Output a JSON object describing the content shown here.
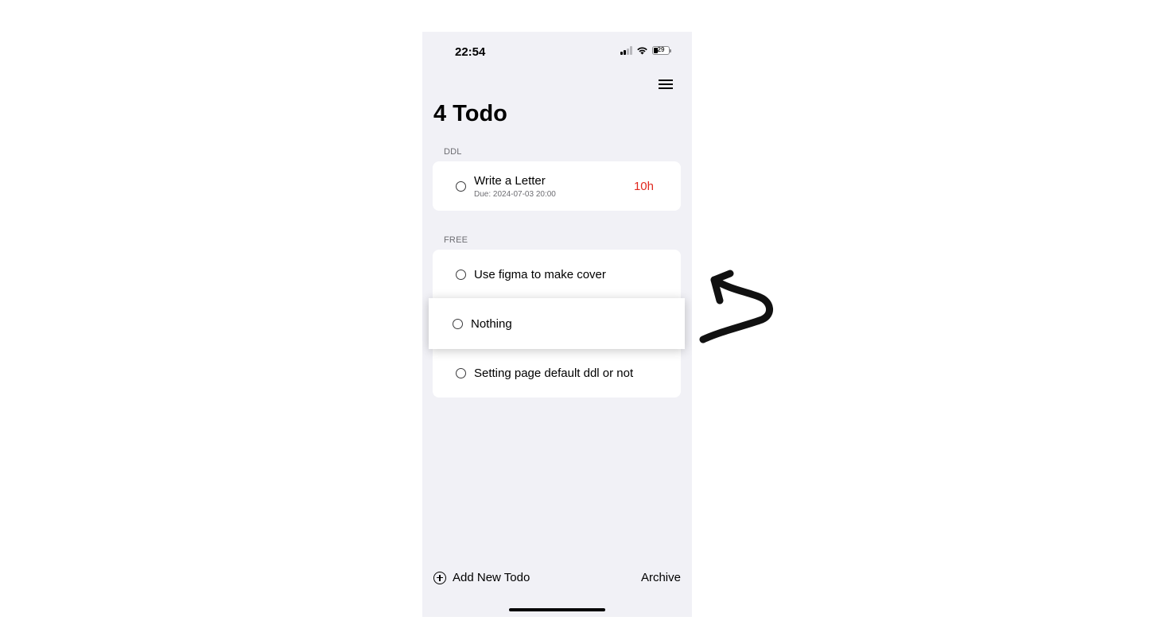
{
  "status_bar": {
    "time": "22:54",
    "battery": "29"
  },
  "header": {
    "title": "4 Todo"
  },
  "sections": {
    "ddl": {
      "label": "DDL",
      "items": [
        {
          "title": "Write a Letter",
          "due": "Due: 2024-07-03 20:00",
          "countdown": "10h"
        }
      ]
    },
    "free": {
      "label": "FREE",
      "items": [
        {
          "title": "Use figma to make cover"
        },
        {
          "title": "Setting page default ddl or not"
        }
      ]
    }
  },
  "dragging_item": {
    "title": "Nothing"
  },
  "bottom_bar": {
    "add_label": "Add New Todo",
    "archive_label": "Archive"
  },
  "colors": {
    "background": "#f1f1f6",
    "card": "#ffffff",
    "countdown": "#e0281e"
  },
  "icons": [
    "signal-icon",
    "wifi-icon",
    "battery-icon",
    "hamburger-menu-icon",
    "radio-circle-icon",
    "add-circle-icon",
    "curved-arrow-annotation"
  ]
}
